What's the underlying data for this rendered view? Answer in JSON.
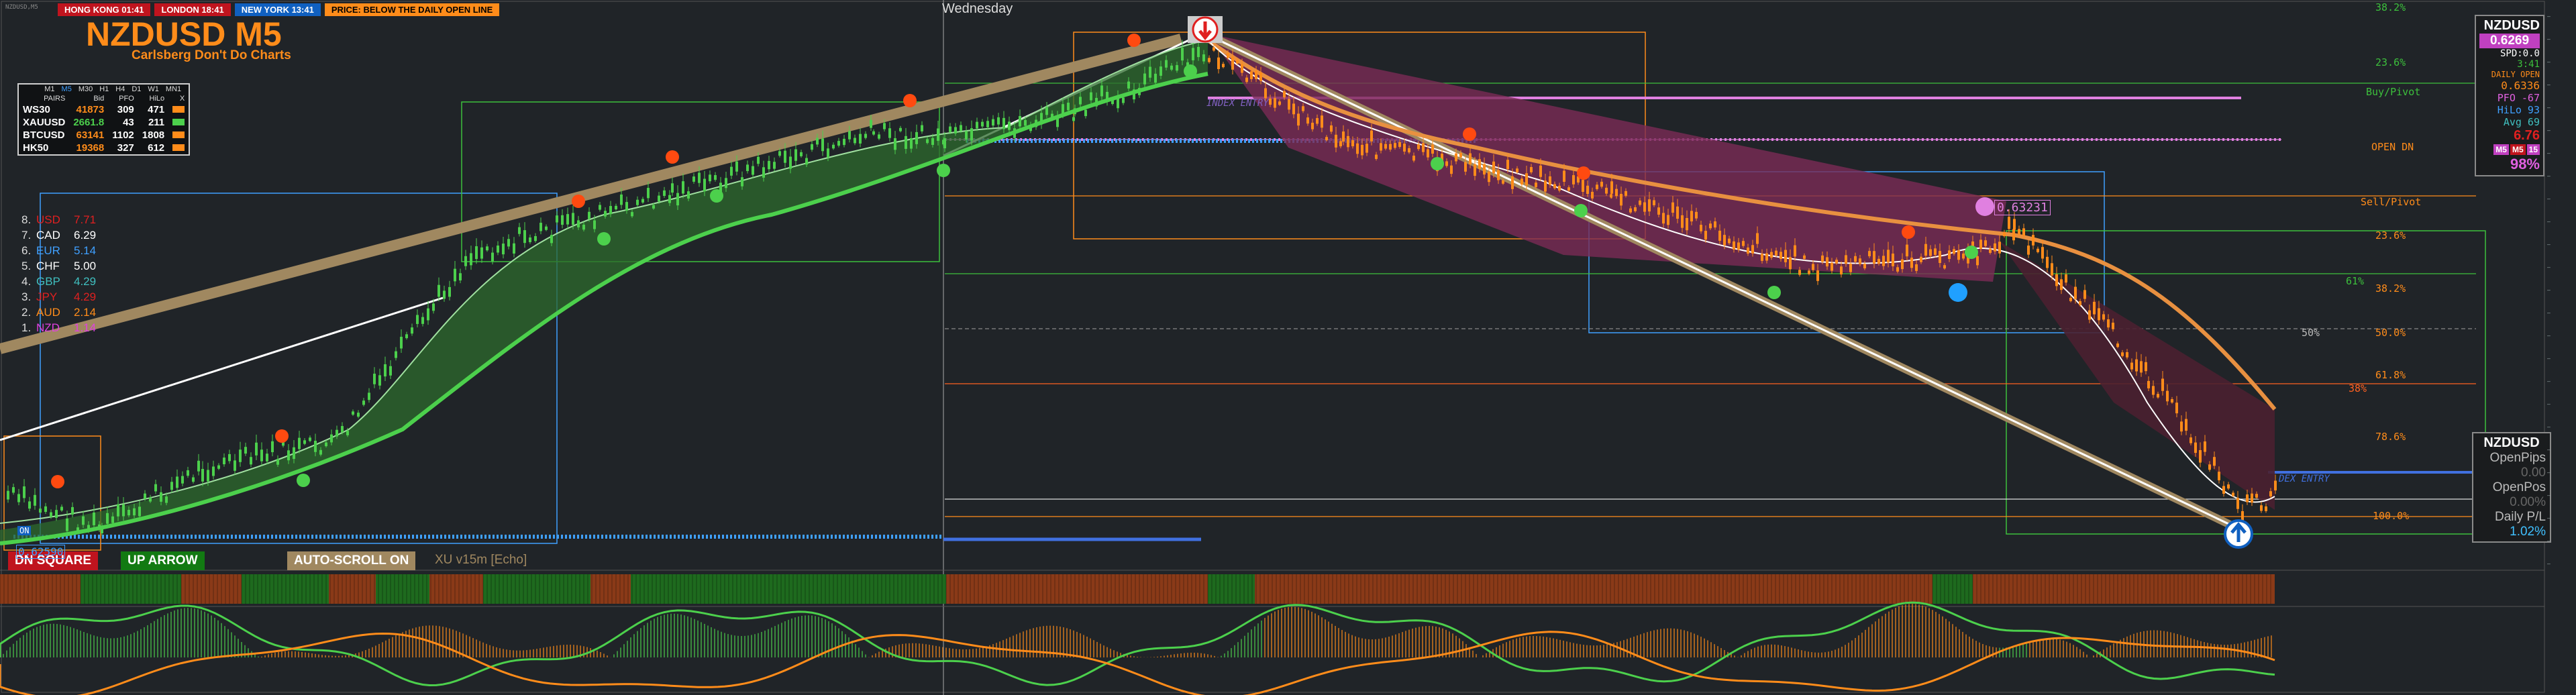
{
  "window": {
    "title": "NZDUSD,M5"
  },
  "sessions": [
    {
      "name": "HONG KONG 01:41",
      "bg": "#c0141e",
      "fg": "#ffffff"
    },
    {
      "name": "LONDON 18:41",
      "bg": "#c0141e",
      "fg": "#ffffff"
    },
    {
      "name": "NEW YORK 13:41",
      "bg": "#1060c0",
      "fg": "#ffffff"
    },
    {
      "name": "PRICE: BELOW THE DAILY OPEN LINE",
      "bg": "#ff8c1a",
      "fg": "#000000"
    }
  ],
  "header": {
    "title": "NZDUSD M5",
    "subtitle": "Carlsberg Don't Do Charts"
  },
  "day_label": "Wednesday",
  "pairs_table": {
    "timeframes": [
      "M1",
      "M5",
      "M30",
      "H1",
      "H4",
      "D1",
      "W1",
      "MN1"
    ],
    "columns": [
      "PAIRS",
      "Bid",
      "PFO",
      "HiLo",
      "X"
    ],
    "rows": [
      {
        "pair": "WS30",
        "bid": "41873",
        "pfo": "309",
        "hilo": "471",
        "color": "#ff8c1a"
      },
      {
        "pair": "XAUUSD",
        "bid": "2661.8",
        "pfo": "43",
        "hilo": "211",
        "color": "#4cd04c"
      },
      {
        "pair": "BTCUSD",
        "bid": "63141",
        "pfo": "1102",
        "hilo": "1808",
        "color": "#ff8c1a"
      },
      {
        "pair": "HK50",
        "bid": "19368",
        "pfo": "327",
        "hilo": "612",
        "color": "#ff8c1a"
      }
    ]
  },
  "currency_strength": [
    {
      "rank": "8.",
      "ccy": "USD",
      "value": "7.71",
      "color": "#e02020"
    },
    {
      "rank": "7.",
      "ccy": "CAD",
      "value": "6.29",
      "color": "#ffffff"
    },
    {
      "rank": "6.",
      "ccy": "EUR",
      "value": "5.14",
      "color": "#3fa0ff"
    },
    {
      "rank": "5.",
      "ccy": "CHF",
      "value": "5.00",
      "color": "#ffffff"
    },
    {
      "rank": "4.",
      "ccy": "GBP",
      "value": "4.29",
      "color": "#40c0c0"
    },
    {
      "rank": "3.",
      "ccy": "JPY",
      "value": "4.29",
      "color": "#e02020"
    },
    {
      "rank": "2.",
      "ccy": "AUD",
      "value": "2.14",
      "color": "#ff8c1a"
    },
    {
      "rank": "1.",
      "ccy": "NZD",
      "value": "1.14",
      "color": "#e040e0"
    }
  ],
  "buttons": {
    "dn_square": "DN SQUARE",
    "up_arrow": "UP ARROW",
    "auto_scroll": "AUTO-SCROLL ON",
    "template": "XU v15m [Echo]"
  },
  "small_labels": {
    "on": "ON",
    "left_price": "0.62590",
    "marker_price": "0.63231",
    "index_entry": "INDEX ENTRY",
    "index_entry_right": "DEX ENTRY"
  },
  "fib_labels": [
    {
      "text": "38.2%",
      "color": "#3cc03c"
    },
    {
      "text": "23.6%",
      "color": "#3cc03c"
    },
    {
      "text": "Buy/Pivot",
      "color": "#3cc03c"
    },
    {
      "text": "OPEN DN",
      "color": "#ff8c1a"
    },
    {
      "text": "Sell/Pivot",
      "color": "#ff8c1a"
    },
    {
      "text": "23.6%",
      "color": "#ff8c1a"
    },
    {
      "text": "61%",
      "color": "#3cc03c"
    },
    {
      "text": "38.2%",
      "color": "#ff8c1a"
    },
    {
      "text": "50%",
      "color": "#bbbbbb"
    },
    {
      "text": "50.0%",
      "color": "#ff8c1a"
    },
    {
      "text": "38%",
      "color": "#ff6020"
    },
    {
      "text": "61.8%",
      "color": "#ff8c1a"
    },
    {
      "text": "78.6%",
      "color": "#ff8c1a"
    },
    {
      "text": "100.0%",
      "color": "#ff8c1a"
    }
  ],
  "info_panel": {
    "pair": "NZDUSD",
    "price": "0.6269",
    "spread": "SPD:0.0",
    "timer": "3:41",
    "daily_open_label": "DAILY OPEN",
    "daily_open": "0.6336",
    "pfo": "PFO -67",
    "hilo": "HiLo 93",
    "avg": "Avg 69",
    "change": "6.76",
    "tf_buttons": [
      "M5",
      "M5",
      "15"
    ],
    "pct": "98%"
  },
  "pips_panel": {
    "pair": "NZDUSD",
    "open_pips_label": "OpenPips",
    "open_pips": "0.00",
    "open_pos_label": "OpenPos",
    "open_pos": "0.00%",
    "daily_pl_label": "Daily P/L",
    "daily_pl": "1.02%"
  },
  "colors": {
    "background": "#202428",
    "bull": "#4cd04c",
    "bear": "#ff8c1a",
    "trend_channel": "#a08860",
    "bear_cloud": "#7a2a55",
    "pink_line": "#e080e0",
    "dotted_blue": "#40a0ff"
  }
}
